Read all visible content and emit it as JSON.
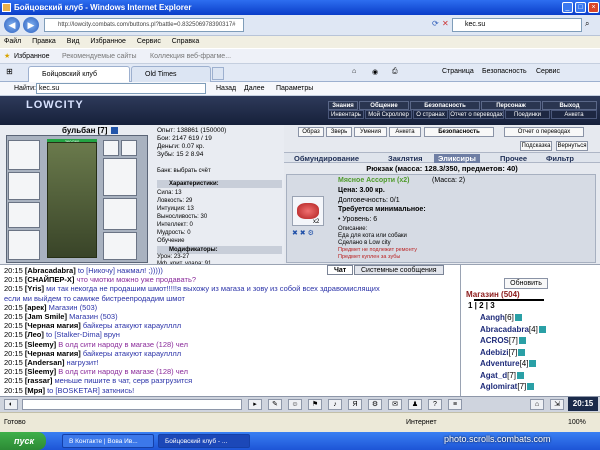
{
  "window": {
    "title": "Бойцовский клуб - Windows Internet Explorer"
  },
  "address": {
    "url": "http://lowcity.combats.com/buttons.pl?battle=0.832506978390317#",
    "search": "kec.su"
  },
  "menu": [
    "Файл",
    "Правка",
    "Вид",
    "Избранное",
    "Сервис",
    "Справка"
  ],
  "favorites": {
    "label": "Избранное",
    "items": [
      "Рекомендуемые сайты",
      "Коллекция веб-фрагме..."
    ]
  },
  "tabs": [
    "Бойцовский клуб",
    "Old Times"
  ],
  "toolbar": {
    "items": [
      "Страница",
      "Безопасность",
      "Сервис"
    ]
  },
  "find": {
    "label": "Найти:",
    "value": "kec.su",
    "back": "Назад",
    "next": "Далее",
    "params": "Параметры"
  },
  "game": {
    "logo": "LOWCITY",
    "nav1": [
      "Знания",
      "Общение",
      "Безопасность",
      "Персонаж",
      "Выход"
    ],
    "nav2": [
      "Инвентарь",
      "Мой Скроллер",
      "О странах",
      "Отчет о переводах",
      "Поединки",
      "Анкета"
    ],
    "char": {
      "name": "бульбан",
      "level": "[7]",
      "hp": "260/260",
      "stats": [
        "Опыт: 138861 (150000)",
        "Бои: 2147 619 / 19",
        "Деньги: 0.07 кр.",
        "Зубы: 15 2 8.94"
      ],
      "bank": "Банк: выбрать счёт",
      "chars_title": "Характеристики:",
      "chars": [
        "Сила: 13",
        "Ловкость: 29",
        "Интуиция: 13",
        "Выносливость: 30",
        "Интеллект: 0",
        "Мудрость: 0",
        "Обучение"
      ],
      "mods_title": "Модификаторы:",
      "mods": [
        "Урон: 23-27",
        "Мф. крит. удара: 91"
      ]
    },
    "char_buttons": [
      "Образ",
      "Зверь",
      "Умения",
      "Анкета",
      "Безопасность",
      "Отчет о переводах"
    ],
    "small_buttons": [
      "Подсказка",
      "Вернуться"
    ],
    "inv_tabs": [
      "Обмундирование",
      "Заклятия",
      "Эликсиры",
      "Прочее",
      "Фильтр"
    ],
    "bag": "Рюкзак (масса: 128.3/350, предметов: 40)",
    "item": {
      "name": "Мясное Ассорти (x2)",
      "mass": "(Масса: 2)",
      "price": "Цена: 3.00 кр.",
      "durability": "Долговечность: 0/1",
      "req_title": "Требуется минимальное:",
      "req": "• Уровень: 6",
      "desc_title": "Описание:",
      "desc1": "Еда для кота или собаки",
      "desc2": "Сделано в Low city",
      "warn1": "Предмет не подлежит ремонту",
      "warn2": "Предмет куплен за зубы",
      "count": "x2"
    }
  },
  "chat": {
    "tabs": [
      "Чат",
      "Системные сообщения"
    ],
    "lines": [
      {
        "time": "20:15",
        "who": "[Abracadabra]",
        "text": " to [Никочу] нажмал! ;)))))"
      },
      {
        "time": "20:15",
        "who": "[СНАЙПЕР-X]",
        "text": " что чмотки можно уже продавать?"
      },
      {
        "time": "20:15",
        "who": "[Yris]",
        "text": " ми так некогда не продашим шмот!!!!!я выхожу из магаза и зову из собой всех здравомислящих"
      },
      {
        "time": "",
        "who": "",
        "text": "если ми выйдем то самиже бистреепродадим шмот"
      },
      {
        "time": "20:15",
        "who": "[арек]",
        "text": " Магазин (503)"
      },
      {
        "time": "20:15",
        "who": "[Jam Smile]",
        "text": " Магазин (503)"
      },
      {
        "time": "20:15",
        "who": "[Черная магия]",
        "text": " байкеры атакуют караулллл"
      },
      {
        "time": "20:15",
        "who": "[Лео]",
        "text": " to [Stalker-Dima] врун"
      },
      {
        "time": "20:15",
        "who": "[Sleemy]",
        "text": " В олд сити народу в магазе (128) чел"
      },
      {
        "time": "20:15",
        "who": "[Черная магия]",
        "text": " байкеры атакуют караулллл"
      },
      {
        "time": "20:15",
        "who": "[Andersan]",
        "text": " нагрузит!"
      },
      {
        "time": "20:15",
        "who": "[Sleemy]",
        "text": " В олд сити народу в магазе (128) чел"
      },
      {
        "time": "20:15",
        "who": "[rassar]",
        "text": " меньше пишите в чат, серв разгрузится"
      },
      {
        "time": "20:15",
        "who": "[Мря]",
        "text": " to [BOSKETAR] заткнись!"
      }
    ]
  },
  "userlist": {
    "refresh": "Обновить",
    "title": "Магазин (504)",
    "pages": "1 | 2 | 3",
    "users": [
      {
        "name": "Aangh",
        "lvl": "[6]"
      },
      {
        "name": "Abracadabra",
        "lvl": "[4]"
      },
      {
        "name": "ACROS",
        "lvl": "[7]"
      },
      {
        "name": "Adebizi",
        "lvl": "[7]"
      },
      {
        "name": "Adventure",
        "lvl": "[4]"
      },
      {
        "name": "Agat_d",
        "lvl": "[7]"
      },
      {
        "name": "Aglomirat",
        "lvl": "[7]"
      }
    ]
  },
  "clock": "20:15",
  "status": {
    "left": "Готово",
    "zone": "Интернет",
    "zoom": "100%"
  },
  "taskbar": {
    "start": "пуск",
    "tasks": [
      "В Контакте | Вова Ив...",
      "Бойцовский клуб - ..."
    ]
  },
  "watermark": "photo.scrolls.combats.com"
}
